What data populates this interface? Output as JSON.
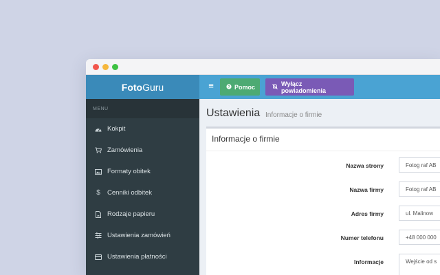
{
  "brand": {
    "bold": "Foto",
    "light": "Guru"
  },
  "topbar": {
    "menu_toggle_glyph": "≡",
    "help_label": "Pomoc",
    "notifications_label": "Wyłącz powiadomienia"
  },
  "sidebar": {
    "header": "MENU",
    "items": [
      {
        "label": "Kokpit",
        "icon": "dashboard-icon"
      },
      {
        "label": "Zamówienia",
        "icon": "cart-icon"
      },
      {
        "label": "Formaty obitek",
        "icon": "image-icon"
      },
      {
        "label": "Cenniki odbitek",
        "icon": "dollar-icon"
      },
      {
        "label": "Rodzaje papieru",
        "icon": "file-icon"
      },
      {
        "label": "Ustawienia zamówień",
        "icon": "sliders-icon"
      },
      {
        "label": "Ustawienia płatności",
        "icon": "credit-card-icon"
      }
    ]
  },
  "main": {
    "title": "Ustawienia",
    "subtitle": "Informacje o firmie",
    "box_title": "Informacje o firmie",
    "fields": [
      {
        "label": "Nazwa strony",
        "value": "Fotog raf AB"
      },
      {
        "label": "Nazwa firmy",
        "value": "Fotog raf AB"
      },
      {
        "label": "Adres firmy",
        "value": "ul. Malinow"
      },
      {
        "label": "Numer telefonu",
        "value": "+48 000 000"
      },
      {
        "label": "Informacje",
        "value": "Wejście od s"
      }
    ]
  },
  "colors": {
    "background": "#cfd4e6",
    "brand": "#3a8ab9",
    "topbar": "#4aa3d3",
    "help_button": "#4daa73",
    "notifications_button": "#7a5ab6",
    "sidebar": "#2f3d43"
  }
}
